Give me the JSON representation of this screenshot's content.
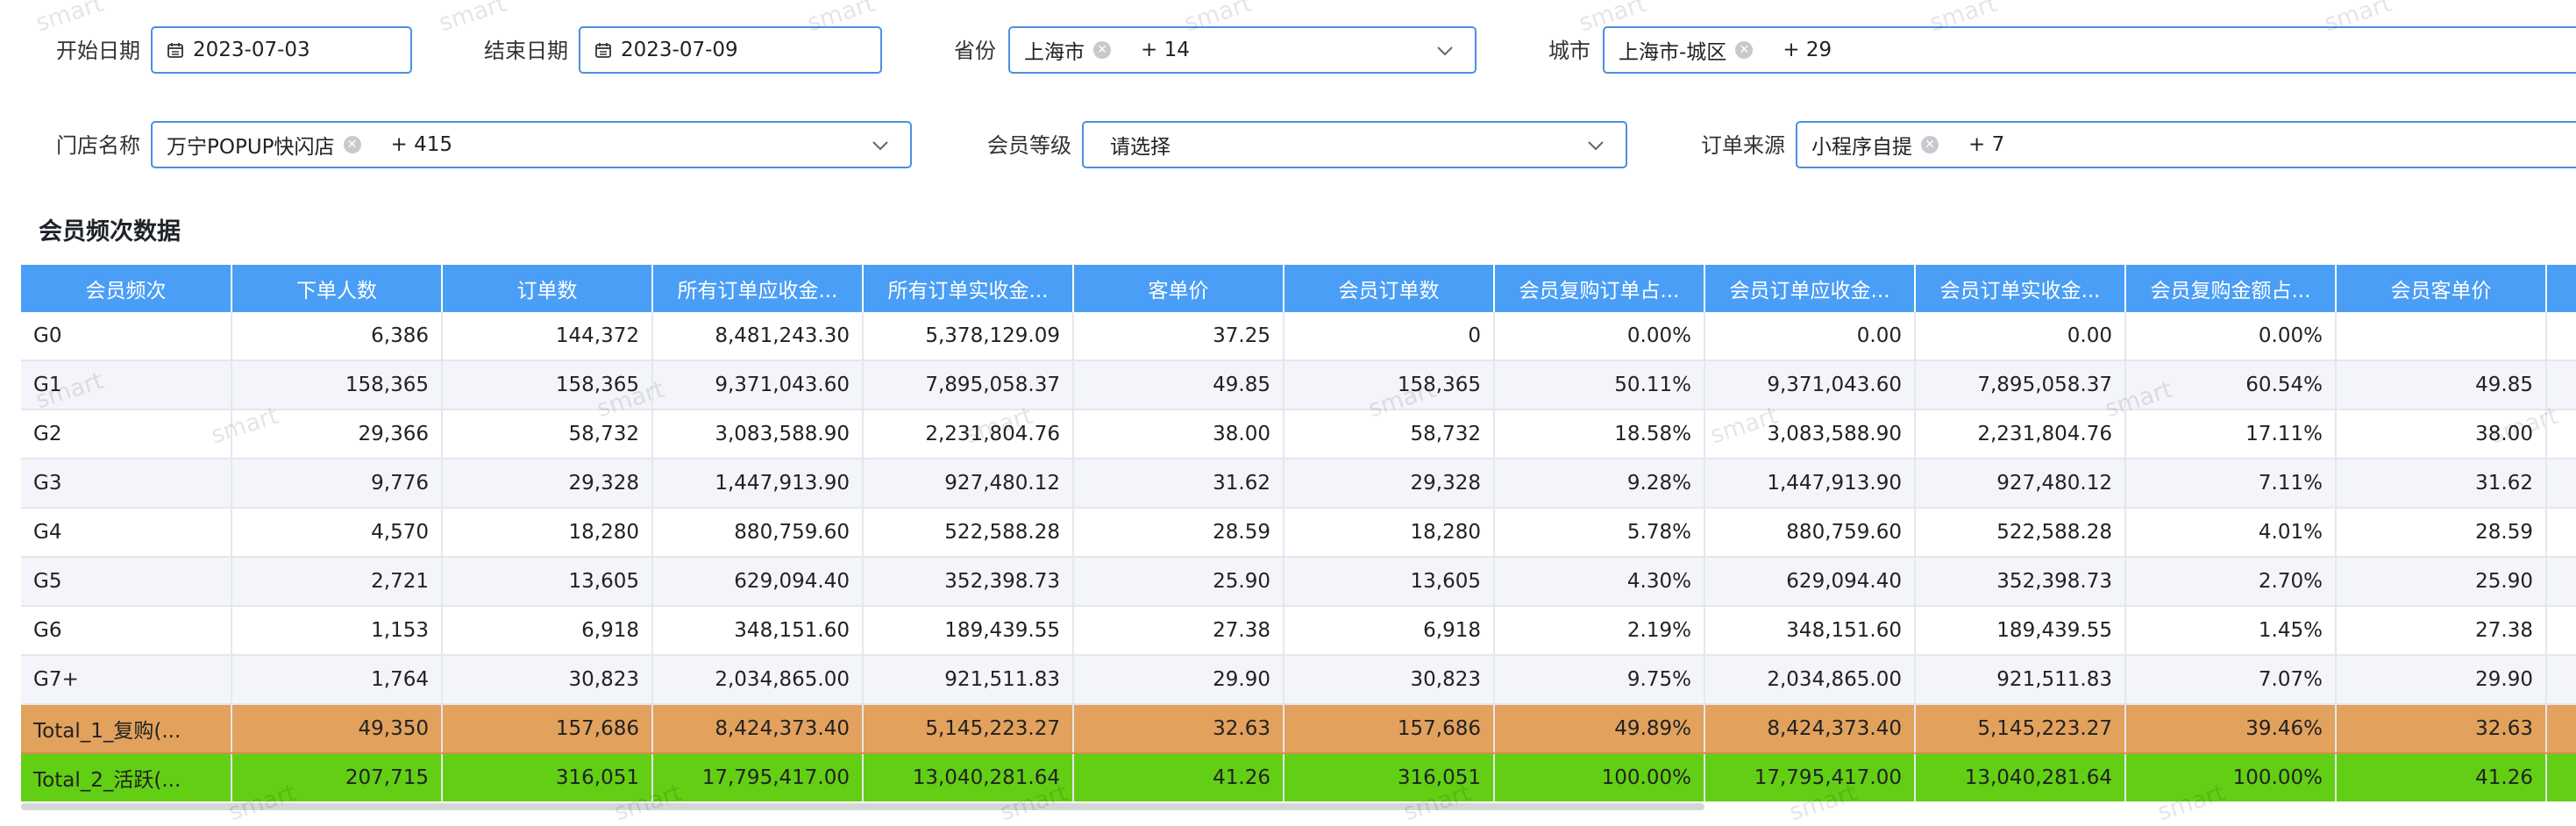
{
  "filters": {
    "start_date": {
      "label": "开始日期",
      "value": "2023-07-03"
    },
    "end_date": {
      "label": "结束日期",
      "value": "2023-07-09"
    },
    "province": {
      "label": "省份",
      "tag": "上海市",
      "more": "+ 14"
    },
    "city": {
      "label": "城市",
      "tag": "上海市-城区",
      "more": "+ 29"
    },
    "store": {
      "label": "门店名称",
      "tag": "万宁POPUP快闪店",
      "more": "+ 415"
    },
    "member_level": {
      "label": "会员等级",
      "placeholder": "请选择"
    },
    "order_source": {
      "label": "订单来源",
      "tag": "小程序自提",
      "more": "+ 7"
    }
  },
  "section_title": "会员频次数据",
  "watermark_text": "smart",
  "table": {
    "headers": [
      "会员频次",
      "下单人数",
      "订单数",
      "所有订单应收金...",
      "所有订单实收金...",
      "客单价",
      "会员订单数",
      "会员复购订单占...",
      "会员订单应收金...",
      "会员订单实收金...",
      "会员复购金额占...",
      "会员客单价",
      ""
    ],
    "rows": [
      {
        "cells": [
          "G0",
          "6,386",
          "144,372",
          "8,481,243.30",
          "5,378,129.09",
          "37.25",
          "0",
          "0.00%",
          "0.00",
          "0.00",
          "0.00%",
          "",
          ""
        ]
      },
      {
        "cells": [
          "G1",
          "158,365",
          "158,365",
          "9,371,043.60",
          "7,895,058.37",
          "49.85",
          "158,365",
          "50.11%",
          "9,371,043.60",
          "7,895,058.37",
          "60.54%",
          "49.85",
          ""
        ]
      },
      {
        "cells": [
          "G2",
          "29,366",
          "58,732",
          "3,083,588.90",
          "2,231,804.76",
          "38.00",
          "58,732",
          "18.58%",
          "3,083,588.90",
          "2,231,804.76",
          "17.11%",
          "38.00",
          ""
        ]
      },
      {
        "cells": [
          "G3",
          "9,776",
          "29,328",
          "1,447,913.90",
          "927,480.12",
          "31.62",
          "29,328",
          "9.28%",
          "1,447,913.90",
          "927,480.12",
          "7.11%",
          "31.62",
          ""
        ]
      },
      {
        "cells": [
          "G4",
          "4,570",
          "18,280",
          "880,759.60",
          "522,588.28",
          "28.59",
          "18,280",
          "5.78%",
          "880,759.60",
          "522,588.28",
          "4.01%",
          "28.59",
          ""
        ]
      },
      {
        "cells": [
          "G5",
          "2,721",
          "13,605",
          "629,094.40",
          "352,398.73",
          "25.90",
          "13,605",
          "4.30%",
          "629,094.40",
          "352,398.73",
          "2.70%",
          "25.90",
          ""
        ]
      },
      {
        "cells": [
          "G6",
          "1,153",
          "6,918",
          "348,151.60",
          "189,439.55",
          "27.38",
          "6,918",
          "2.19%",
          "348,151.60",
          "189,439.55",
          "1.45%",
          "27.38",
          ""
        ]
      },
      {
        "cells": [
          "G7+",
          "1,764",
          "30,823",
          "2,034,865.00",
          "921,511.83",
          "29.90",
          "30,823",
          "9.75%",
          "2,034,865.00",
          "921,511.83",
          "7.07%",
          "29.90",
          ""
        ]
      },
      {
        "cells": [
          "Total_1_复购(...",
          "49,350",
          "157,686",
          "8,424,373.40",
          "5,145,223.27",
          "32.63",
          "157,686",
          "49.89%",
          "8,424,373.40",
          "5,145,223.27",
          "39.46%",
          "32.63",
          ""
        ],
        "style": "total1",
        "color": "#e2a15d"
      },
      {
        "cells": [
          "Total_2_活跃(...",
          "207,715",
          "316,051",
          "17,795,417.00",
          "13,040,281.64",
          "41.26",
          "316,051",
          "100.00%",
          "17,795,417.00",
          "13,040,281.64",
          "100.00%",
          "41.26",
          ""
        ],
        "style": "total2",
        "color": "#62cf14"
      }
    ]
  },
  "colors": {
    "header": "#4a9ef5",
    "input_border": "#4a90e2"
  }
}
